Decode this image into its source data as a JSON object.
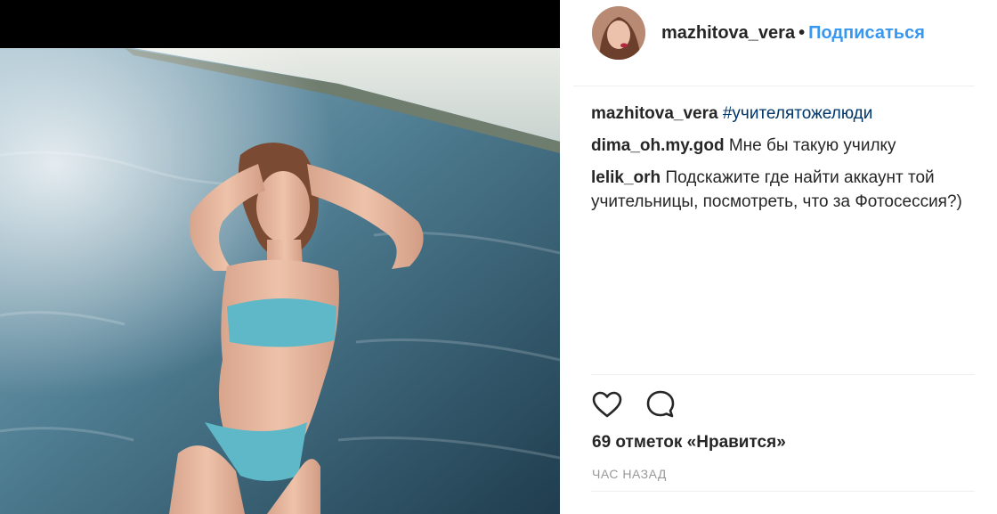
{
  "post": {
    "username": "mazhitova_vera",
    "follow_label": "Подписаться",
    "separator": "•"
  },
  "comments": [
    {
      "user": "mazhitova_vera",
      "text": "",
      "tag": "#учителятожелюди"
    },
    {
      "user": "dima_oh.my.god",
      "text": "Мне бы такую училку",
      "tag": ""
    },
    {
      "user": "lelik_orh",
      "text": "Подскажите где найти аккаунт той учительницы, посмотреть, что за Фотосессия?)",
      "tag": ""
    }
  ],
  "stats": {
    "likes": "69 отметок «Нравится»",
    "time": "ЧАС НАЗАД"
  },
  "icons": {
    "like": "heart-icon",
    "comment": "speech-bubble-icon"
  },
  "colors": {
    "link": "#3897f0",
    "hashtag": "#003569",
    "text": "#262626",
    "muted": "#999999"
  }
}
